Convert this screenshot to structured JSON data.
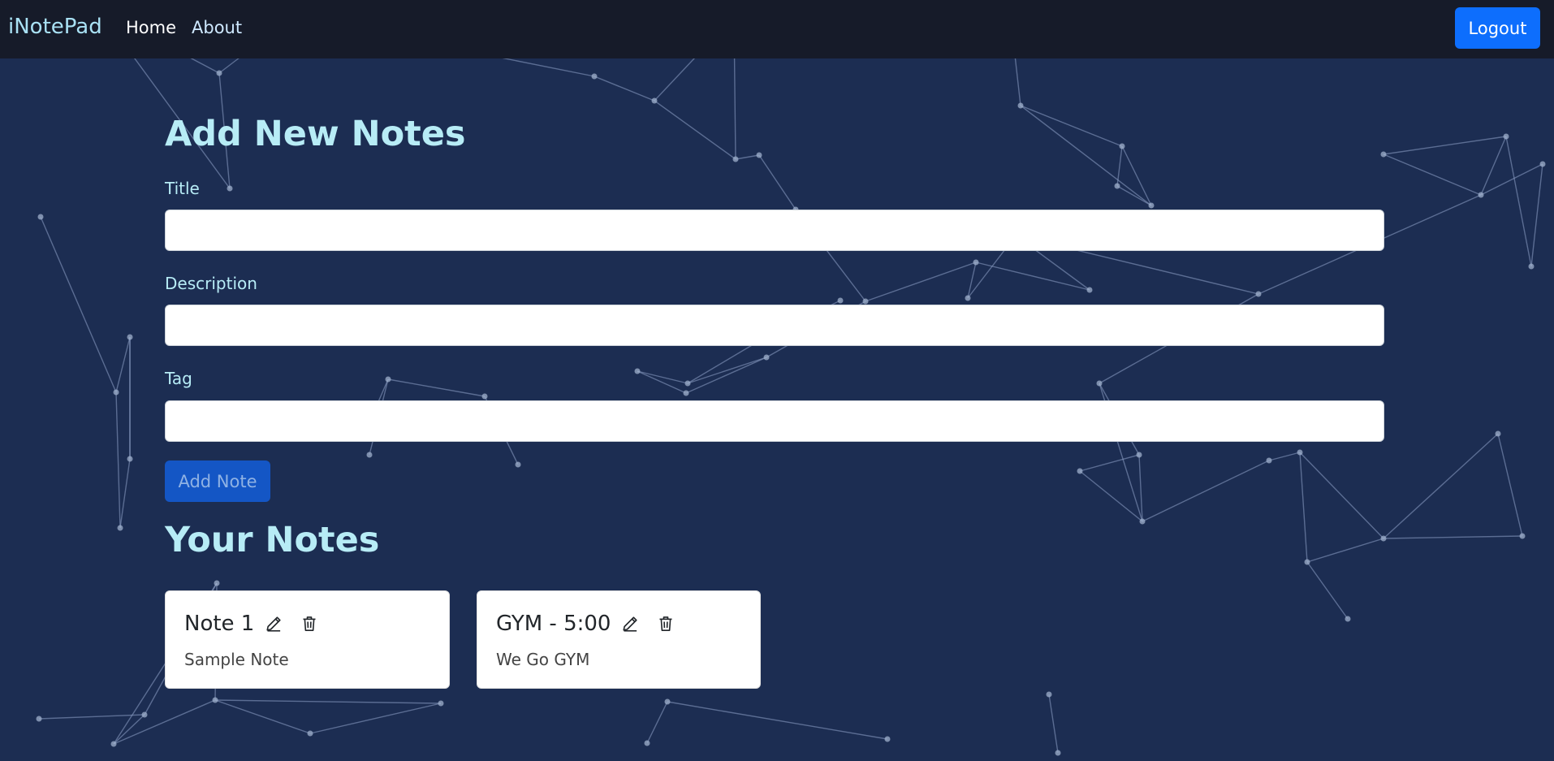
{
  "navbar": {
    "brand": "iNotePad",
    "links": [
      {
        "label": "Home"
      },
      {
        "label": "About"
      }
    ],
    "logout_label": "Logout"
  },
  "form": {
    "heading": "Add New Notes",
    "title_label": "Title",
    "title_value": "",
    "description_label": "Description",
    "description_value": "",
    "tag_label": "Tag",
    "tag_value": "",
    "submit_label": "Add Note"
  },
  "notes": {
    "heading": "Your Notes",
    "items": [
      {
        "title": "Note 1",
        "description": "Sample Note",
        "edit_icon": "pencil-icon",
        "delete_icon": "trash-icon"
      },
      {
        "title": "GYM - 5:00",
        "description": "We Go GYM",
        "edit_icon": "pencil-icon",
        "delete_icon": "trash-icon"
      }
    ]
  },
  "colors": {
    "navbar_bg": "#161b29",
    "page_bg": "#1c2d52",
    "accent": "#0d6efd",
    "heading_text": "#b7ecf6"
  }
}
